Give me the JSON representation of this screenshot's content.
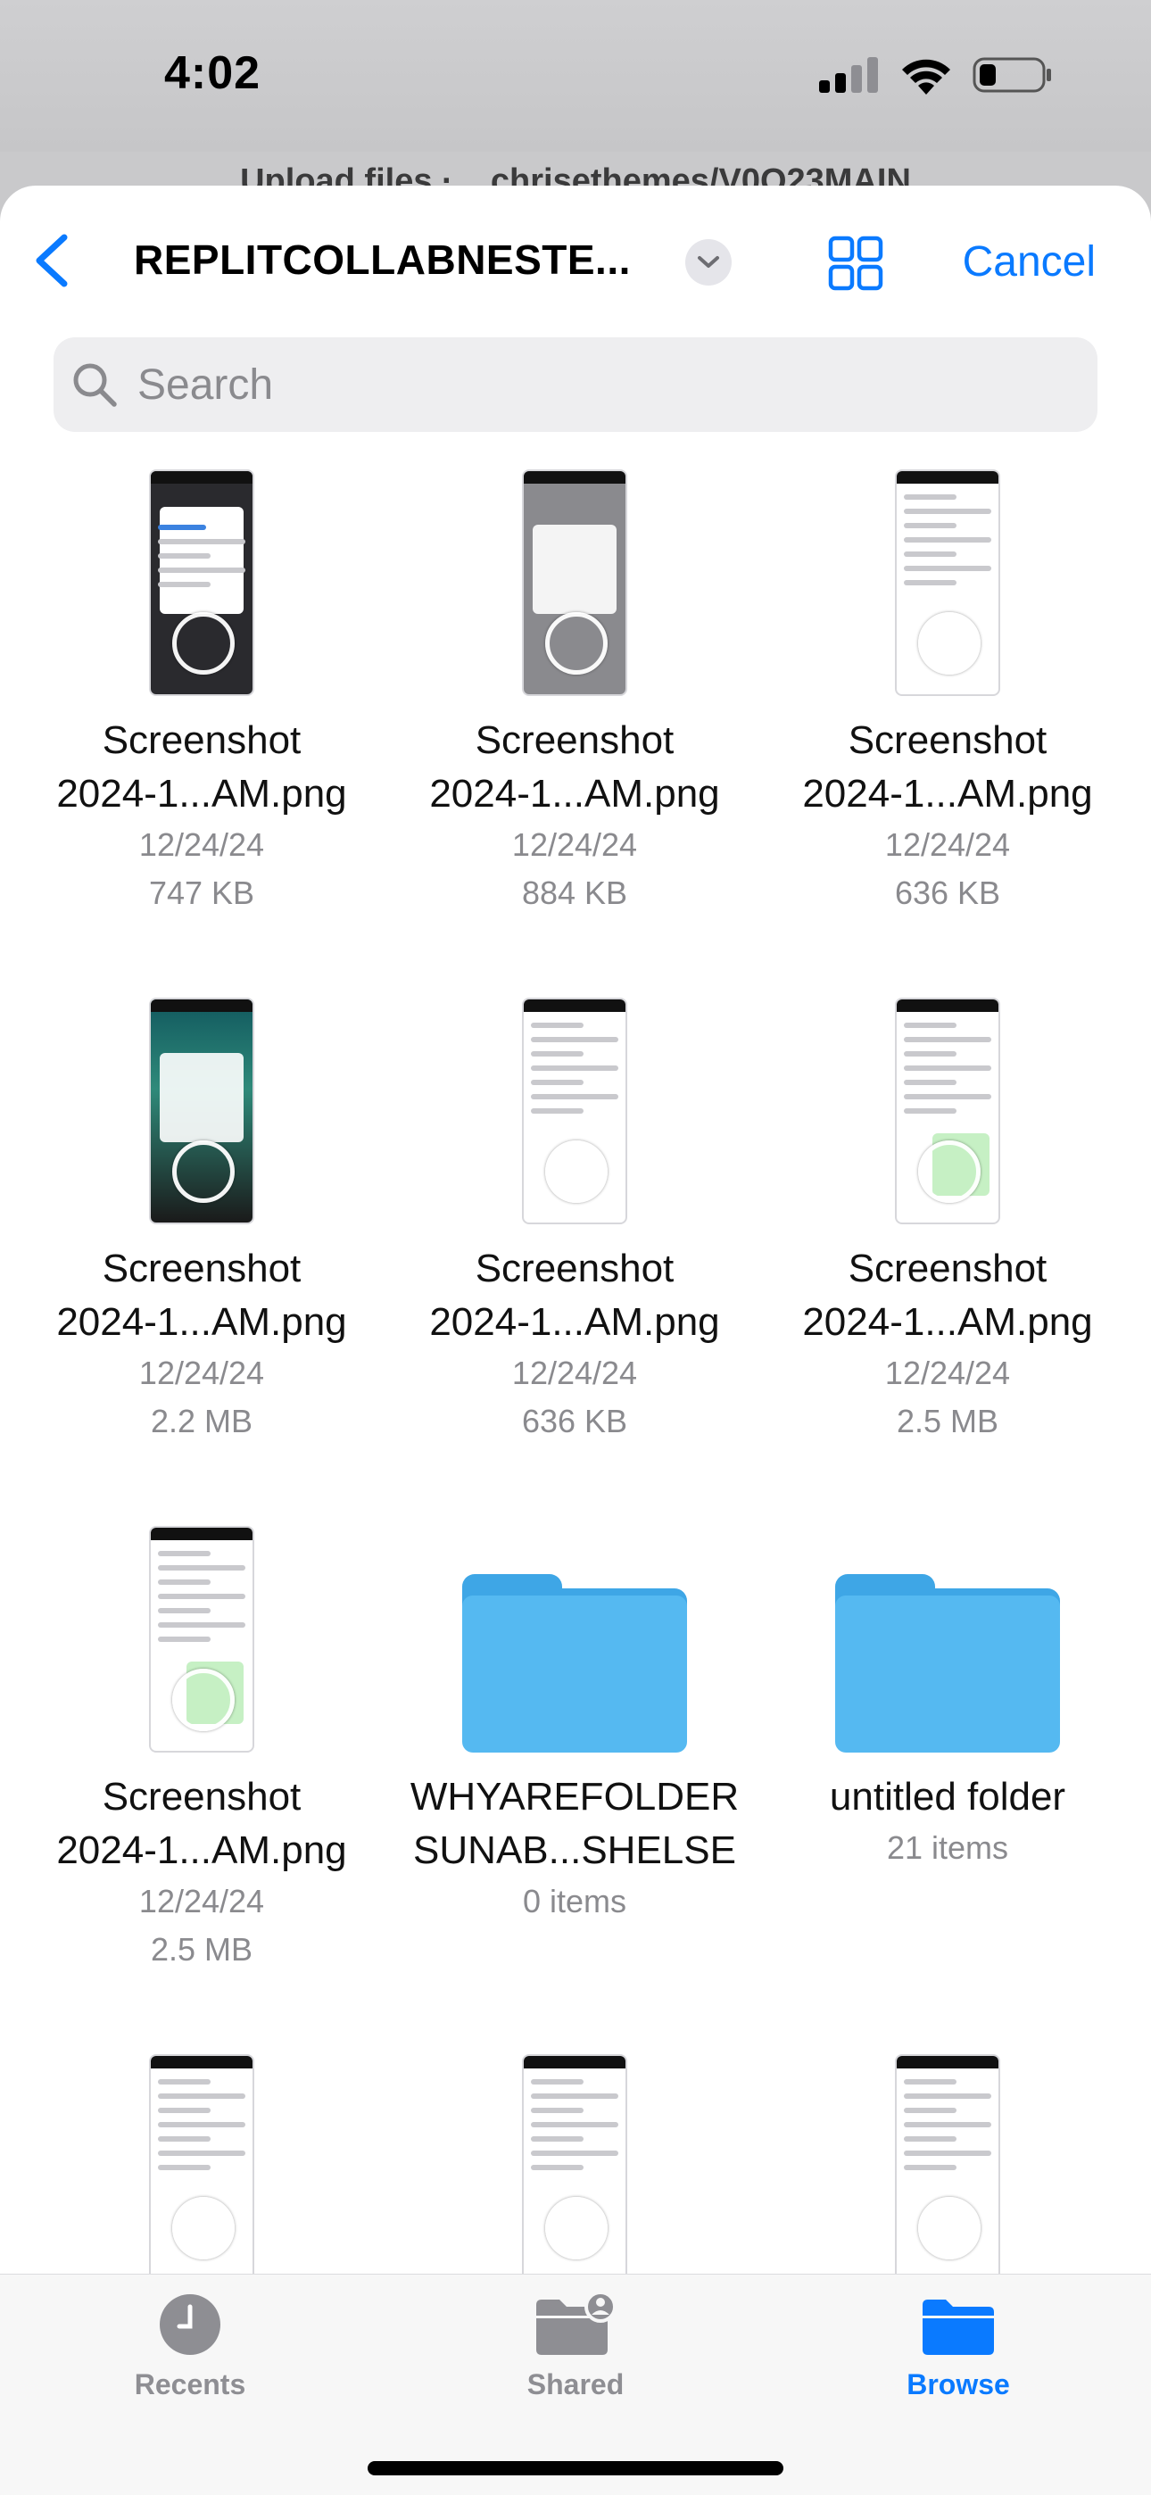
{
  "status": {
    "time": "4:02"
  },
  "behind": {
    "title": "Upload files · ...chrisethemes/V0O23MAIN"
  },
  "nav": {
    "folder_title": "REPLITCOLLABNESTE...",
    "cancel_label": "Cancel"
  },
  "search": {
    "placeholder": "Search"
  },
  "items": [
    {
      "kind": "image",
      "thumb": "dark",
      "line1": "Screenshot",
      "line2": "2024-1...AM.png",
      "date": "12/24/24",
      "size": "747 KB"
    },
    {
      "kind": "image",
      "thumb": "gray",
      "line1": "Screenshot",
      "line2": "2024-1...AM.png",
      "date": "12/24/24",
      "size": "884 KB"
    },
    {
      "kind": "image",
      "thumb": "chats",
      "line1": "Screenshot",
      "line2": "2024-1...AM.png",
      "date": "12/24/24",
      "size": "636 KB"
    },
    {
      "kind": "image",
      "thumb": "teal",
      "line1": "Screenshot",
      "line2": "2024-1...AM.png",
      "date": "12/24/24",
      "size": "2.2 MB"
    },
    {
      "kind": "image",
      "thumb": "chats",
      "line1": "Screenshot",
      "line2": "2024-1...AM.png",
      "date": "12/24/24",
      "size": "636 KB"
    },
    {
      "kind": "image",
      "thumb": "chat-green",
      "line1": "Screenshot",
      "line2": "2024-1...AM.png",
      "date": "12/24/24",
      "size": "2.5 MB"
    },
    {
      "kind": "image",
      "thumb": "chat-green",
      "line1": "Screenshot",
      "line2": "2024-1...AM.png",
      "date": "12/24/24",
      "size": "2.5 MB"
    },
    {
      "kind": "folder",
      "line1": "WHYAREFOLDER",
      "line2": "SUNAB...SHELSE",
      "meta": "0 items"
    },
    {
      "kind": "folder",
      "line1": "untitled folder",
      "meta": "21 items"
    },
    {
      "kind": "image",
      "thumb": "chats"
    },
    {
      "kind": "image",
      "thumb": "chats"
    },
    {
      "kind": "image",
      "thumb": "chats"
    }
  ],
  "tabs": [
    {
      "label": "Recents",
      "icon": "clock-icon",
      "active": false
    },
    {
      "label": "Shared",
      "icon": "shared-folder-icon",
      "active": false
    },
    {
      "label": "Browse",
      "icon": "folder-icon",
      "active": true
    }
  ],
  "colors": {
    "accent": "#0a7aff",
    "folder": "#55b9f1",
    "secondary_text": "#8a8a8e"
  }
}
